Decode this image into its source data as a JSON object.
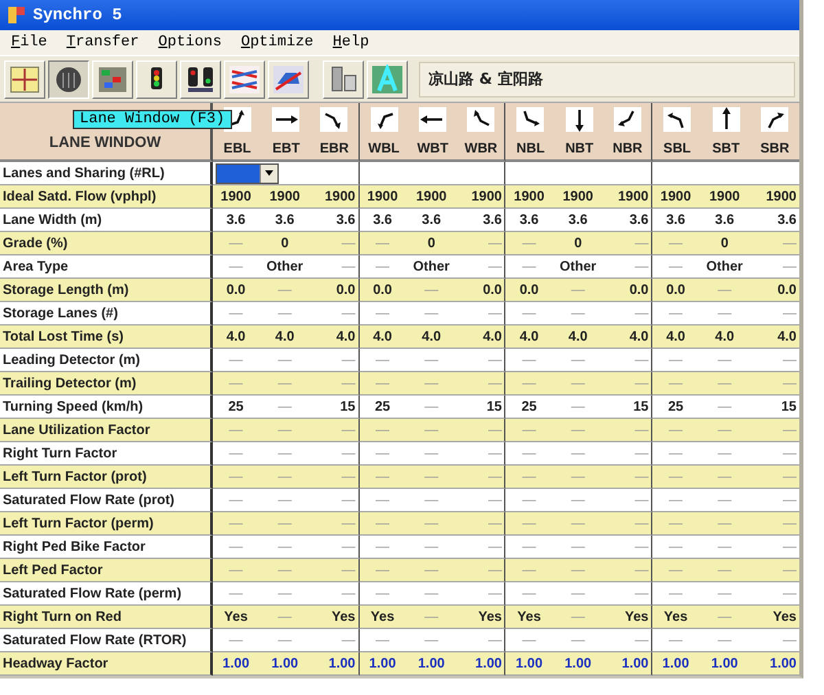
{
  "window": {
    "title": "Synchro 5"
  },
  "menu": [
    "File",
    "Transfer",
    "Options",
    "Optimize",
    "Help"
  ],
  "toolbar": [
    {
      "kind": "map",
      "selected": false
    },
    {
      "kind": "lanes",
      "selected": true
    },
    {
      "kind": "volume",
      "selected": false
    },
    {
      "kind": "timing",
      "selected": false
    },
    {
      "kind": "phasing",
      "selected": false
    },
    {
      "kind": "coordination",
      "selected": false
    },
    {
      "kind": "simulation",
      "selected": false
    },
    {
      "kind": "detail",
      "selected": false
    },
    {
      "kind": "report",
      "selected": false
    }
  ],
  "intersection": "凉山路 & 宜阳路",
  "tooltip": "Lane Window (F3)",
  "table": {
    "title": "LANE WINDOW",
    "columns": [
      "EBL",
      "EBT",
      "EBR",
      "WBL",
      "WBT",
      "WBR",
      "NBL",
      "NBT",
      "NBR",
      "SBL",
      "SBT",
      "SBR"
    ],
    "rows": [
      {
        "label": "Lanes and Sharing (#RL)",
        "kind": "select"
      },
      {
        "label": "Ideal Satd. Flow (vphpl)",
        "kind": "text",
        "cells": [
          "1900",
          "1900",
          "1900",
          "1900",
          "1900",
          "1900",
          "1900",
          "1900",
          "1900",
          "1900",
          "1900",
          "1900"
        ]
      },
      {
        "label": "Lane Width (m)",
        "kind": "text",
        "cells": [
          "3.6",
          "3.6",
          "3.6",
          "3.6",
          "3.6",
          "3.6",
          "3.6",
          "3.6",
          "3.6",
          "3.6",
          "3.6",
          "3.6"
        ]
      },
      {
        "label": "Grade (%)",
        "kind": "text",
        "cells": [
          "—",
          "0",
          "—",
          "—",
          "0",
          "—",
          "—",
          "0",
          "—",
          "—",
          "0",
          "—"
        ]
      },
      {
        "label": "Area Type",
        "kind": "text",
        "cells": [
          "—",
          "Other",
          "—",
          "—",
          "Other",
          "—",
          "—",
          "Other",
          "—",
          "—",
          "Other",
          "—"
        ]
      },
      {
        "label": "Storage Length (m)",
        "kind": "text",
        "cells": [
          "0.0",
          "—",
          "0.0",
          "0.0",
          "—",
          "0.0",
          "0.0",
          "—",
          "0.0",
          "0.0",
          "—",
          "0.0"
        ]
      },
      {
        "label": "Storage Lanes (#)",
        "kind": "text",
        "cells": [
          "—",
          "—",
          "—",
          "—",
          "—",
          "—",
          "—",
          "—",
          "—",
          "—",
          "—",
          "—"
        ]
      },
      {
        "label": "Total Lost Time (s)",
        "kind": "text",
        "cells": [
          "4.0",
          "4.0",
          "4.0",
          "4.0",
          "4.0",
          "4.0",
          "4.0",
          "4.0",
          "4.0",
          "4.0",
          "4.0",
          "4.0"
        ]
      },
      {
        "label": "Leading Detector (m)",
        "kind": "text",
        "cells": [
          "—",
          "—",
          "—",
          "—",
          "—",
          "—",
          "—",
          "—",
          "—",
          "—",
          "—",
          "—"
        ]
      },
      {
        "label": "Trailing Detector (m)",
        "kind": "text",
        "cells": [
          "—",
          "—",
          "—",
          "—",
          "—",
          "—",
          "—",
          "—",
          "—",
          "—",
          "—",
          "—"
        ]
      },
      {
        "label": "Turning Speed (km/h)",
        "kind": "text",
        "cells": [
          "25",
          "—",
          "15",
          "25",
          "—",
          "15",
          "25",
          "—",
          "15",
          "25",
          "—",
          "15"
        ]
      },
      {
        "label": "Lane Utilization Factor",
        "kind": "text",
        "cells": [
          "—",
          "—",
          "—",
          "—",
          "—",
          "—",
          "—",
          "—",
          "—",
          "—",
          "—",
          "—"
        ]
      },
      {
        "label": "Right Turn Factor",
        "kind": "text",
        "cells": [
          "—",
          "—",
          "—",
          "—",
          "—",
          "—",
          "—",
          "—",
          "—",
          "—",
          "—",
          "—"
        ]
      },
      {
        "label": "Left Turn Factor (prot)",
        "kind": "text",
        "cells": [
          "—",
          "—",
          "—",
          "—",
          "—",
          "—",
          "—",
          "—",
          "—",
          "—",
          "—",
          "—"
        ]
      },
      {
        "label": "Saturated Flow Rate (prot)",
        "kind": "text",
        "cells": [
          "—",
          "—",
          "—",
          "—",
          "—",
          "—",
          "—",
          "—",
          "—",
          "—",
          "—",
          "—"
        ]
      },
      {
        "label": "Left Turn Factor (perm)",
        "kind": "text",
        "cells": [
          "—",
          "—",
          "—",
          "—",
          "—",
          "—",
          "—",
          "—",
          "—",
          "—",
          "—",
          "—"
        ]
      },
      {
        "label": "Right Ped Bike Factor",
        "kind": "text",
        "cells": [
          "—",
          "—",
          "—",
          "—",
          "—",
          "—",
          "—",
          "—",
          "—",
          "—",
          "—",
          "—"
        ]
      },
      {
        "label": "Left Ped Factor",
        "kind": "text",
        "cells": [
          "—",
          "—",
          "—",
          "—",
          "—",
          "—",
          "—",
          "—",
          "—",
          "—",
          "—",
          "—"
        ]
      },
      {
        "label": "Saturated Flow Rate (perm)",
        "kind": "text",
        "cells": [
          "—",
          "—",
          "—",
          "—",
          "—",
          "—",
          "—",
          "—",
          "—",
          "—",
          "—",
          "—"
        ]
      },
      {
        "label": "Right Turn on Red",
        "kind": "text",
        "cells": [
          "Yes",
          "—",
          "Yes",
          "Yes",
          "—",
          "Yes",
          "Yes",
          "—",
          "Yes",
          "Yes",
          "—",
          "Yes"
        ]
      },
      {
        "label": "Saturated Flow Rate (RTOR)",
        "kind": "text",
        "cells": [
          "—",
          "—",
          "—",
          "—",
          "—",
          "—",
          "—",
          "—",
          "—",
          "—",
          "—",
          "—"
        ]
      },
      {
        "label": "Headway Factor",
        "kind": "input",
        "cells": [
          "1.00",
          "1.00",
          "1.00",
          "1.00",
          "1.00",
          "1.00",
          "1.00",
          "1.00",
          "1.00",
          "1.00",
          "1.00",
          "1.00"
        ]
      }
    ]
  }
}
